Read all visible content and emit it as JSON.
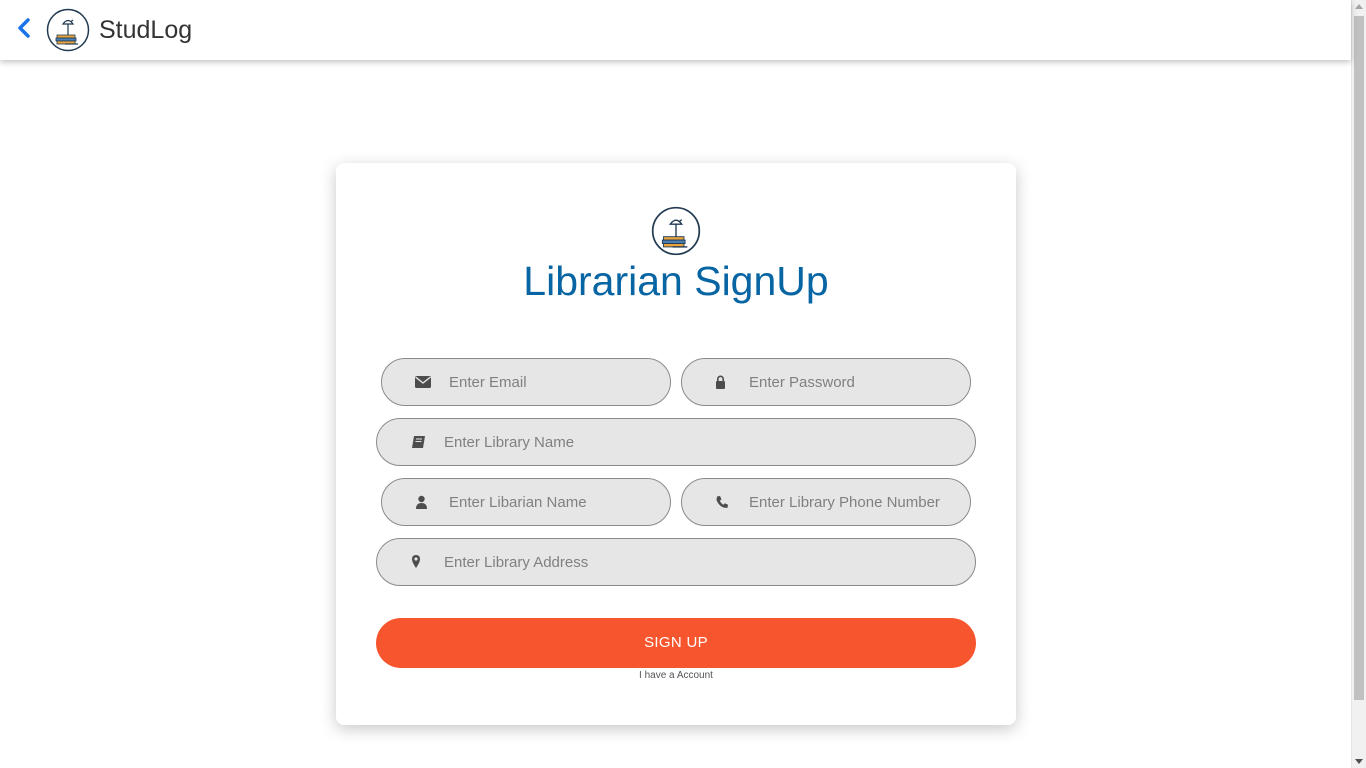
{
  "header": {
    "title": "StudLog",
    "back_icon": "chevron-left-icon",
    "logo_icon": "library-lamp-logo"
  },
  "card": {
    "title": "Librarian SignUp",
    "logo_icon": "library-lamp-logo"
  },
  "form": {
    "email_placeholder": "Enter Email",
    "password_placeholder": "Enter Password",
    "library_name_placeholder": "Enter Library Name",
    "librarian_name_placeholder": "Enter Libarian Name",
    "phone_placeholder": "Enter Library Phone Number",
    "address_placeholder": "Enter Library Address",
    "submit_label": "SIGN UP",
    "account_link": "I have a Account"
  },
  "colors": {
    "accent_blue": "#0765a3",
    "button_orange": "#f7552d",
    "back_icon_blue": "#1a73e8",
    "field_bg": "#e6e6e6"
  }
}
